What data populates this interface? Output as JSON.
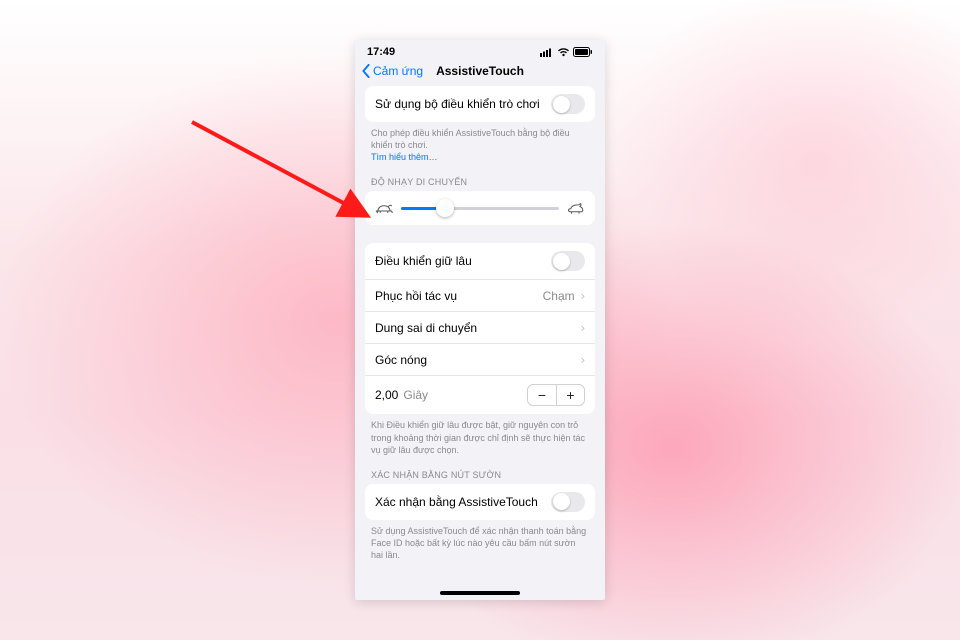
{
  "statusbar": {
    "time": "17:49"
  },
  "nav": {
    "back": "Cảm ứng",
    "title": "AssistiveTouch"
  },
  "gameController": {
    "label": "Sử dụng bộ điều khiển trò chơi",
    "caption": "Cho phép điều khiển AssistiveTouch bằng bộ điều khiển trò chơi.",
    "learnMore": "Tìm hiểu thêm…"
  },
  "tracking": {
    "header": "ĐỘ NHẠY DI CHUYỂN",
    "value_pct": 28
  },
  "dwell": {
    "rows": {
      "holdControl": "Điều khiển giữ lâu",
      "restoreAction": "Phục hồi tác vụ",
      "restoreActionValue": "Chạm",
      "moveTolerance": "Dung sai di chuyển",
      "hotCorners": "Góc nóng"
    },
    "seconds": {
      "value": "2,00",
      "unit": "Giây"
    },
    "caption": "Khi Điều khiển giữ lâu được bật, giữ nguyên con trỏ trong khoảng thời gian được chỉ định sẽ thực hiện tác vụ giữ lâu được chọn."
  },
  "sideButton": {
    "header": "XÁC NHẬN BẰNG NÚT SƯỜN",
    "label": "Xác nhận bằng AssistiveTouch",
    "caption": "Sử dụng AssistiveTouch để xác nhận thanh toán bằng Face ID hoặc bất kỳ lúc nào yêu cầu bấm nút sườn hai lần."
  }
}
